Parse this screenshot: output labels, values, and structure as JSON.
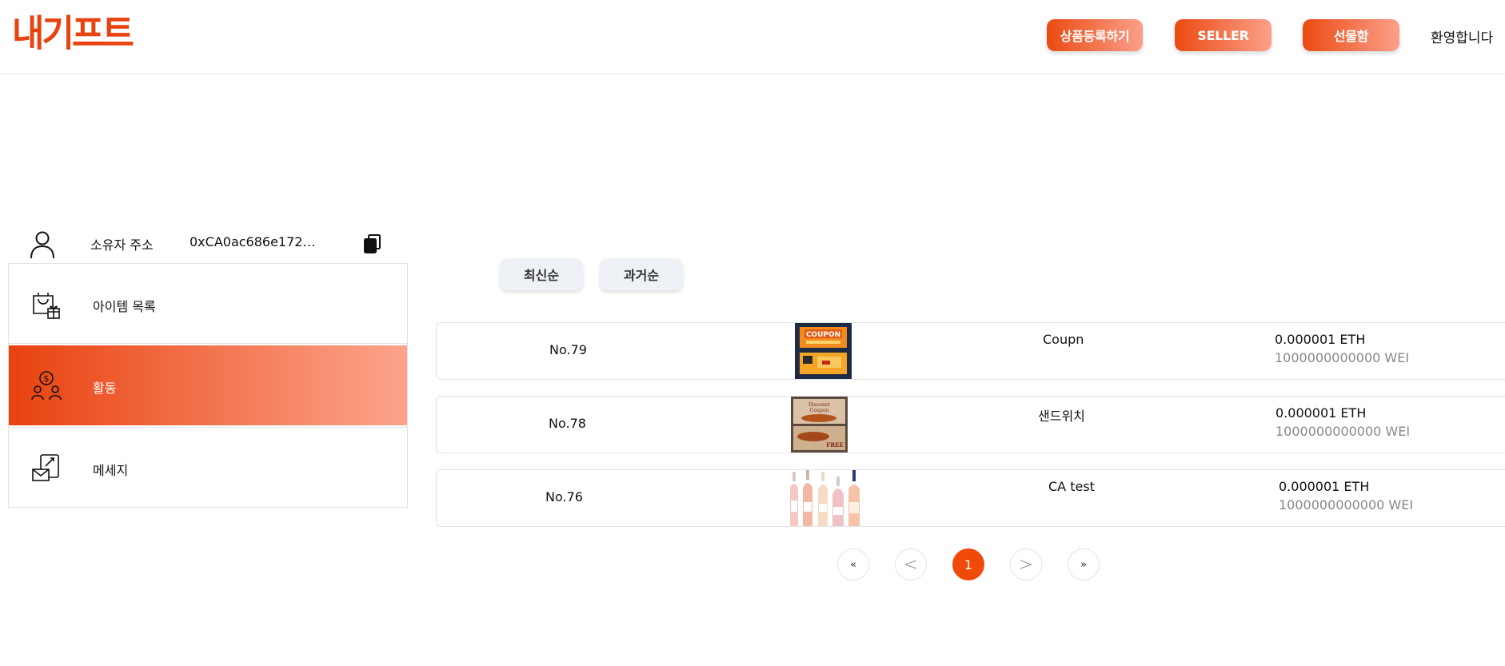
{
  "header": {
    "logo": "내기프트",
    "buttons": {
      "register": "상품등록하기",
      "seller": "SELLER",
      "giftbox": "선물함"
    },
    "welcome": "환영합니다"
  },
  "owner": {
    "label": "소유자 주소",
    "address": "0xCA0ac686e1727···",
    "icon": "user-icon",
    "copy_icon": "copy-icon"
  },
  "menu": {
    "items": [
      {
        "label": "아이템 목록",
        "icon": "shopping-bag-gift-icon",
        "active": false
      },
      {
        "label": "활동",
        "icon": "people-coin-icon",
        "active": true
      },
      {
        "label": "메세지",
        "icon": "message-envelope-icon",
        "active": false
      }
    ]
  },
  "sort": {
    "newest": "최신순",
    "oldest": "과거순"
  },
  "items": [
    {
      "no": "No.79",
      "name": "Coupn",
      "eth": "0.000001 ETH",
      "wei": "1000000000000 WEI",
      "thumb": "coupon-image"
    },
    {
      "no": "No.78",
      "name": "샌드위치",
      "eth": "0.000001 ETH",
      "wei": "1000000000000 WEI",
      "thumb": "sandwich-coupon-image"
    },
    {
      "no": "No.76",
      "name": "CA test",
      "eth": "0.000001 ETH",
      "wei": "1000000000000 WEI",
      "thumb": "wine-bottles-image"
    }
  ],
  "pagination": {
    "first": "«",
    "prev": "<",
    "current": "1",
    "next": ">",
    "last": "»"
  },
  "colors": {
    "accent": "#e8420f",
    "accent_light": "#fda48c",
    "border": "#e2e2e2"
  }
}
